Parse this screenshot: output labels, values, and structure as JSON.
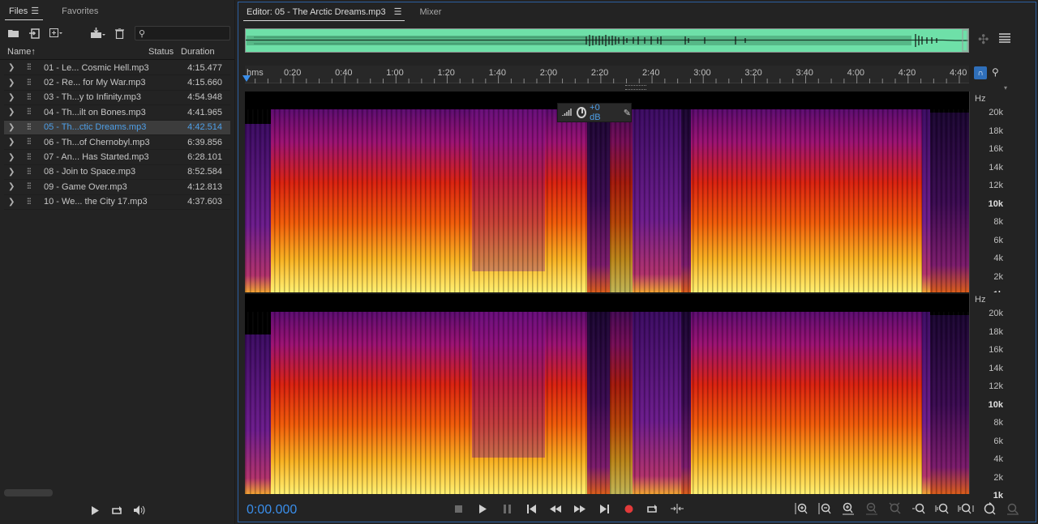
{
  "files_panel": {
    "tabs": [
      {
        "label": "Files",
        "active": true
      },
      {
        "label": "Favorites",
        "active": false
      }
    ],
    "menu_icon": "hamburger-menu-icon",
    "toolbar_icons": [
      "open-folder-icon",
      "import-file-icon",
      "new-file-icon",
      "insert-into-multitrack-icon",
      "delete-icon"
    ],
    "search": {
      "value": "",
      "placeholder": ""
    },
    "columns": {
      "name": "Name",
      "sort_arrow": "↑",
      "status": "Status",
      "duration": "Duration"
    },
    "files": [
      {
        "name": "01 - Le... Cosmic Hell.mp3",
        "duration": "4:15.477",
        "selected": false
      },
      {
        "name": "02 - Re... for My War.mp3",
        "duration": "4:15.660",
        "selected": false
      },
      {
        "name": "03 - Th...y to Infinity.mp3",
        "duration": "4:54.948",
        "selected": false
      },
      {
        "name": "04 - Th...ilt on Bones.mp3",
        "duration": "4:41.965",
        "selected": false
      },
      {
        "name": "05 - Th...ctic Dreams.mp3",
        "duration": "4:42.514",
        "selected": true
      },
      {
        "name": "06 - Th...of Chernobyl.mp3",
        "duration": "6:39.856",
        "selected": false
      },
      {
        "name": "07 - An... Has Started.mp3",
        "duration": "6:28.101",
        "selected": false
      },
      {
        "name": "08 - Join to Space.mp3",
        "duration": "8:52.584",
        "selected": false
      },
      {
        "name": "09 - Game Over.mp3",
        "duration": "4:12.813",
        "selected": false
      },
      {
        "name": "10 - We... the City 17.mp3",
        "duration": "4:37.603",
        "selected": false
      }
    ],
    "transport_icons": [
      "play-icon",
      "loop-icon",
      "autoplay-volume-icon"
    ]
  },
  "editor": {
    "tabs": [
      {
        "label": "Editor: 05 - The Arctic Dreams.mp3",
        "active": true
      },
      {
        "label": "Mixer",
        "active": false
      }
    ],
    "ruler": {
      "unit": "hms",
      "labels": [
        "0:20",
        "0:40",
        "1:00",
        "1:20",
        "1:40",
        "2:00",
        "2:20",
        "2:40",
        "3:00",
        "3:20",
        "3:40",
        "4:00",
        "4:20",
        "4:40"
      ]
    },
    "hz_axis": {
      "unit": "Hz",
      "labels": [
        {
          "text": "20k",
          "bold": false
        },
        {
          "text": "18k",
          "bold": false
        },
        {
          "text": "16k",
          "bold": false
        },
        {
          "text": "14k",
          "bold": false
        },
        {
          "text": "12k",
          "bold": false
        },
        {
          "text": "10k",
          "bold": true
        },
        {
          "text": "8k",
          "bold": false
        },
        {
          "text": "6k",
          "bold": false
        },
        {
          "text": "4k",
          "bold": false
        },
        {
          "text": "2k",
          "bold": false
        },
        {
          "text": "1k",
          "bold": true
        }
      ]
    },
    "hud": {
      "gain": "+0 dB"
    },
    "time_display": "0:00.000",
    "transport_icons": [
      "stop-icon",
      "play-icon",
      "pause-icon",
      "move-to-previous-icon",
      "rewind-icon",
      "fast-forward-icon",
      "move-to-next-icon",
      "record-icon",
      "loop-playback-icon",
      "skip-selection-icon"
    ],
    "zoom_icons": [
      "zoom-in-amplitude-icon",
      "zoom-out-amplitude-icon",
      "zoom-in-time-icon",
      "zoom-out-time-icon",
      "zoom-out-full-icon",
      "zoom-in-point-icon",
      "zoom-in-selection-icon",
      "zoom-selection-icon",
      "zoom-reset-icon",
      "zoom-full-icon"
    ]
  }
}
